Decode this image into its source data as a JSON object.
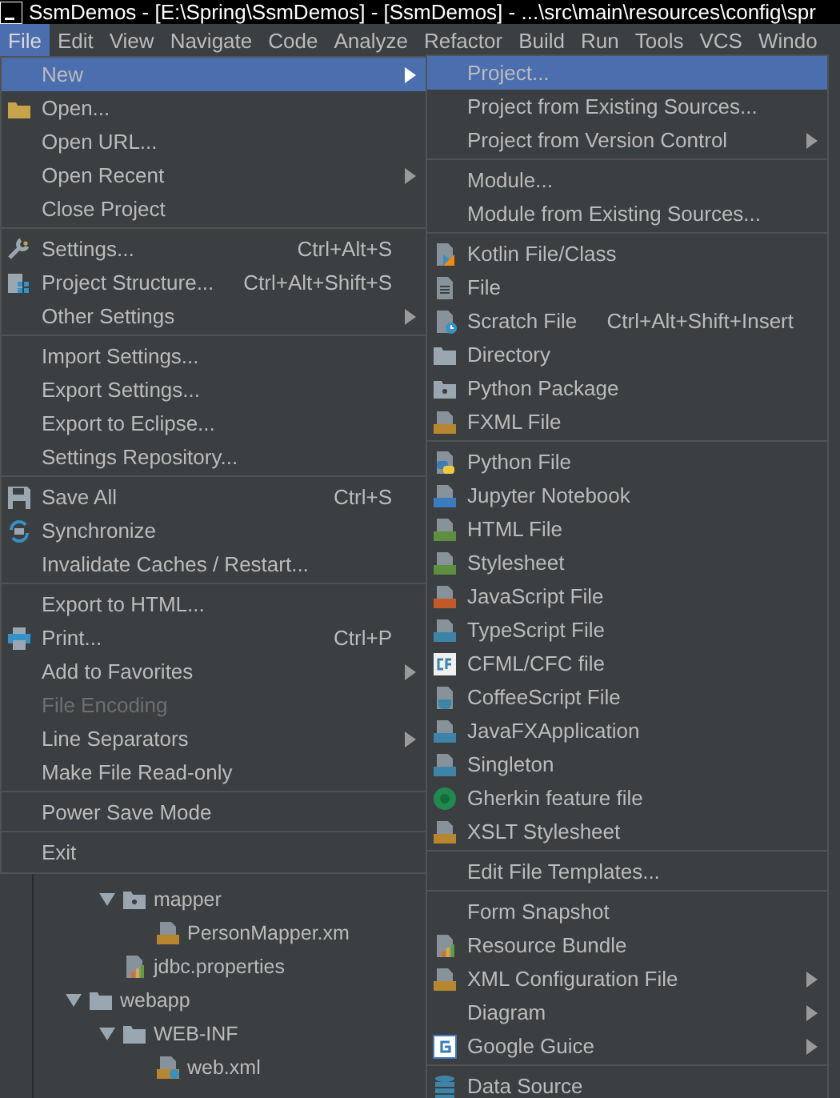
{
  "window": {
    "title": "SsmDemos - [E:\\Spring\\SsmDemos] - [SsmDemos] - ...\\src\\main\\resources\\config\\spr"
  },
  "menubar": [
    {
      "label": "File",
      "selected": true
    },
    {
      "label": "Edit",
      "selected": false
    },
    {
      "label": "View",
      "selected": false
    },
    {
      "label": "Navigate",
      "selected": false
    },
    {
      "label": "Code",
      "selected": false
    },
    {
      "label": "Analyze",
      "selected": false
    },
    {
      "label": "Refactor",
      "selected": false
    },
    {
      "label": "Build",
      "selected": false
    },
    {
      "label": "Run",
      "selected": false
    },
    {
      "label": "Tools",
      "selected": false
    },
    {
      "label": "VCS",
      "selected": false
    },
    {
      "label": "Windo",
      "selected": false
    }
  ],
  "file_menu": [
    {
      "kind": "item",
      "label": "New",
      "submenu": true,
      "selected": true,
      "disabled": false
    },
    {
      "kind": "item",
      "label": "Open...",
      "selected": false,
      "disabled": false
    },
    {
      "kind": "item",
      "label": "Open URL...",
      "selected": false,
      "disabled": false
    },
    {
      "kind": "item",
      "label": "Open Recent",
      "submenu": true,
      "selected": false,
      "disabled": false
    },
    {
      "kind": "item",
      "label": "Close Project",
      "selected": false,
      "disabled": false
    },
    {
      "kind": "separator"
    },
    {
      "kind": "item",
      "label": "Settings...",
      "shortcut": "Ctrl+Alt+S",
      "selected": false,
      "disabled": false
    },
    {
      "kind": "item",
      "label": "Project Structure...",
      "shortcut": "Ctrl+Alt+Shift+S",
      "selected": false,
      "disabled": false
    },
    {
      "kind": "item",
      "label": "Other Settings",
      "submenu": true,
      "selected": false,
      "disabled": false
    },
    {
      "kind": "separator"
    },
    {
      "kind": "item",
      "label": "Import Settings...",
      "selected": false,
      "disabled": false
    },
    {
      "kind": "item",
      "label": "Export Settings...",
      "selected": false,
      "disabled": false
    },
    {
      "kind": "item",
      "label": "Export to Eclipse...",
      "selected": false,
      "disabled": false
    },
    {
      "kind": "item",
      "label": "Settings Repository...",
      "selected": false,
      "disabled": false
    },
    {
      "kind": "separator"
    },
    {
      "kind": "item",
      "label": "Save All",
      "shortcut": "Ctrl+S",
      "selected": false,
      "disabled": false
    },
    {
      "kind": "item",
      "label": "Synchronize",
      "selected": false,
      "disabled": false
    },
    {
      "kind": "item",
      "label": "Invalidate Caches / Restart...",
      "selected": false,
      "disabled": false
    },
    {
      "kind": "separator"
    },
    {
      "kind": "item",
      "label": "Export to HTML...",
      "selected": false,
      "disabled": false
    },
    {
      "kind": "item",
      "label": "Print...",
      "shortcut": "Ctrl+P",
      "selected": false,
      "disabled": false
    },
    {
      "kind": "item",
      "label": "Add to Favorites",
      "submenu": true,
      "selected": false,
      "disabled": false
    },
    {
      "kind": "item",
      "label": "File Encoding",
      "selected": false,
      "disabled": true
    },
    {
      "kind": "item",
      "label": "Line Separators",
      "submenu": true,
      "selected": false,
      "disabled": false
    },
    {
      "kind": "item",
      "label": "Make File Read-only",
      "selected": false,
      "disabled": false
    },
    {
      "kind": "separator"
    },
    {
      "kind": "item",
      "label": "Power Save Mode",
      "selected": false,
      "disabled": false
    },
    {
      "kind": "separator"
    },
    {
      "kind": "item",
      "label": "Exit",
      "selected": false,
      "disabled": false
    }
  ],
  "new_submenu": [
    {
      "kind": "item",
      "label": "Project...",
      "selected": true,
      "disabled": false
    },
    {
      "kind": "item",
      "label": "Project from Existing Sources...",
      "selected": false,
      "disabled": false
    },
    {
      "kind": "item",
      "label": "Project from Version Control",
      "submenu": true,
      "selected": false,
      "disabled": false
    },
    {
      "kind": "separator"
    },
    {
      "kind": "item",
      "label": "Module...",
      "selected": false,
      "disabled": false
    },
    {
      "kind": "item",
      "label": "Module from Existing Sources...",
      "selected": false,
      "disabled": false
    },
    {
      "kind": "separator"
    },
    {
      "kind": "item",
      "label": "Kotlin File/Class",
      "selected": false,
      "disabled": false
    },
    {
      "kind": "item",
      "label": "File",
      "selected": false,
      "disabled": false
    },
    {
      "kind": "item",
      "label": "Scratch File",
      "shortcut": "Ctrl+Alt+Shift+Insert",
      "selected": false,
      "disabled": false
    },
    {
      "kind": "item",
      "label": "Directory",
      "selected": false,
      "disabled": false
    },
    {
      "kind": "item",
      "label": "Python Package",
      "selected": false,
      "disabled": false
    },
    {
      "kind": "item",
      "label": "FXML File",
      "selected": false,
      "disabled": false
    },
    {
      "kind": "separator"
    },
    {
      "kind": "item",
      "label": "Python File",
      "selected": false,
      "disabled": false
    },
    {
      "kind": "item",
      "label": "Jupyter Notebook",
      "selected": false,
      "disabled": false
    },
    {
      "kind": "item",
      "label": "HTML File",
      "selected": false,
      "disabled": false
    },
    {
      "kind": "item",
      "label": "Stylesheet",
      "selected": false,
      "disabled": false
    },
    {
      "kind": "item",
      "label": "JavaScript File",
      "selected": false,
      "disabled": false
    },
    {
      "kind": "item",
      "label": "TypeScript File",
      "selected": false,
      "disabled": false
    },
    {
      "kind": "item",
      "label": "CFML/CFC file",
      "selected": false,
      "disabled": false
    },
    {
      "kind": "item",
      "label": "CoffeeScript File",
      "selected": false,
      "disabled": false
    },
    {
      "kind": "item",
      "label": "JavaFXApplication",
      "selected": false,
      "disabled": false
    },
    {
      "kind": "item",
      "label": "Singleton",
      "selected": false,
      "disabled": false
    },
    {
      "kind": "item",
      "label": "Gherkin feature file",
      "selected": false,
      "disabled": false
    },
    {
      "kind": "item",
      "label": "XSLT Stylesheet",
      "selected": false,
      "disabled": false
    },
    {
      "kind": "separator"
    },
    {
      "kind": "item",
      "label": "Edit File Templates...",
      "selected": false,
      "disabled": false
    },
    {
      "kind": "separator"
    },
    {
      "kind": "item",
      "label": "Form Snapshot",
      "selected": false,
      "disabled": false
    },
    {
      "kind": "item",
      "label": "Resource Bundle",
      "selected": false,
      "disabled": false
    },
    {
      "kind": "item",
      "label": "XML Configuration File",
      "submenu": true,
      "selected": false,
      "disabled": false
    },
    {
      "kind": "item",
      "label": "Diagram",
      "submenu": true,
      "selected": false,
      "disabled": false
    },
    {
      "kind": "item",
      "label": "Google Guice",
      "submenu": true,
      "selected": false,
      "disabled": false
    },
    {
      "kind": "separator"
    },
    {
      "kind": "item",
      "label": "Data Source",
      "selected": false,
      "disabled": false
    }
  ],
  "project_tree": [
    {
      "children": [
        {
          "label": "mapper",
          "kind": "package",
          "expanded": true,
          "children": [
            {
              "label": "PersonMapper.xm",
              "kind": "xml"
            }
          ]
        },
        {
          "label": "jdbc.properties",
          "kind": "bundle"
        }
      ]
    },
    {
      "label": "webapp",
      "kind": "directory",
      "expanded": true,
      "children": [
        {
          "label": "WEB-INF",
          "kind": "directory",
          "expanded": true,
          "children": [
            {
              "label": "web.xml",
              "kind": "webxml"
            }
          ]
        }
      ]
    }
  ]
}
